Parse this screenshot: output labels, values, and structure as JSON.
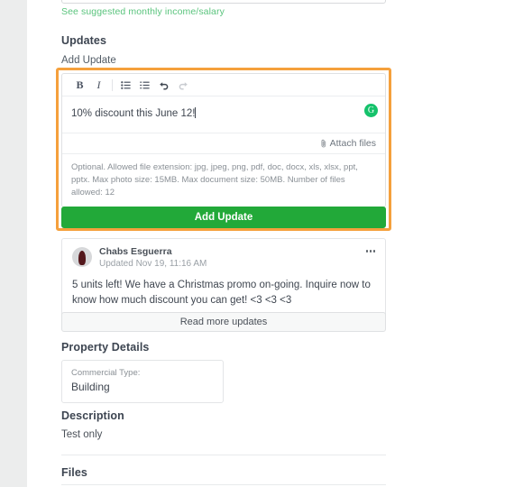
{
  "suggest_link": "See suggested monthly income/salary",
  "updates": {
    "heading": "Updates",
    "add_label": "Add Update"
  },
  "editor": {
    "toolbar": {
      "bold": "B",
      "italic": "I",
      "bullet_list": "bullet-list",
      "numbered_list": "numbered-list",
      "undo": "undo",
      "redo": "redo"
    },
    "content": "10% discount this June 12!",
    "grammarly_badge": "G",
    "attach_label": "Attach files",
    "help_text": "Optional. Allowed file extension: jpg, jpeg, png, pdf, doc, docx, xls, xlsx, ppt, pptx. Max photo size: 15MB. Max document size: 50MB. Number of files allowed: 12"
  },
  "submit_button": "Add Update",
  "update_post": {
    "author": "Chabs Esguerra",
    "timestamp": "Updated Nov 19, 11:16 AM",
    "body": "5 units left! We have a Christmas promo on-going. Inquire now to know how much discount you can get! <3 <3 <3",
    "menu_icon": "more-options"
  },
  "read_more_button": "Read more updates",
  "property_details": {
    "heading": "Property Details",
    "field_label": "Commercial Type:",
    "field_value": "Building"
  },
  "description": {
    "heading": "Description",
    "text": "Test only"
  },
  "files": {
    "heading": "Files"
  },
  "colors": {
    "accent_green": "#22a939",
    "link_green": "#5ac47d",
    "focus_orange": "#f5a03c",
    "grammarly_green": "#15c26b"
  }
}
